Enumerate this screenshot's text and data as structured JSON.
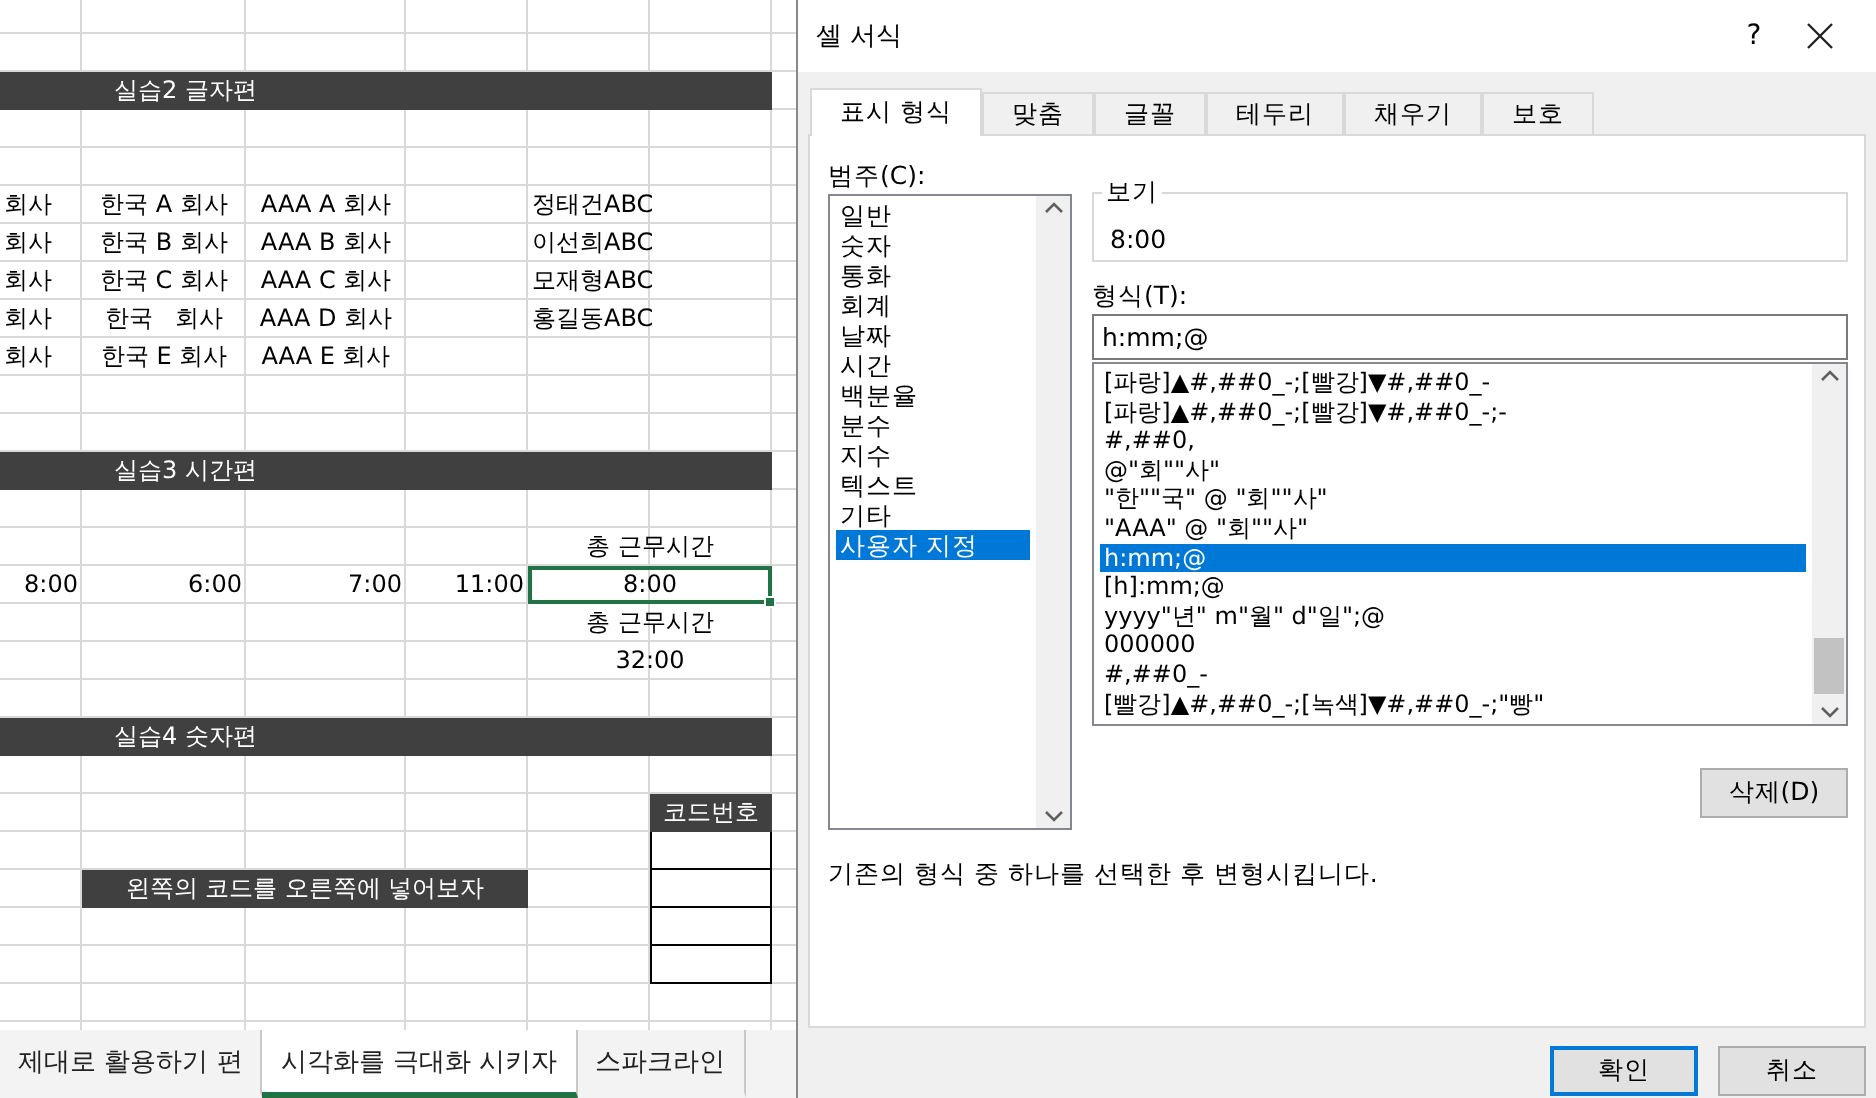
{
  "sheet": {
    "rows": [
      {
        "kind": "blank"
      },
      {
        "kind": "blank"
      },
      {
        "kind": "banner",
        "text": "실습2 글자편"
      },
      {
        "kind": "blank"
      },
      {
        "kind": "blank"
      },
      {
        "kind": "entries",
        "cells": [
          "회사",
          "한국 A 회사",
          "AAA A 회사",
          null,
          "정태건ABC",
          null
        ]
      },
      {
        "kind": "entries",
        "cells": [
          "회사",
          "한국 B 회사",
          "AAA B 회사",
          null,
          "이선희ABC",
          null
        ]
      },
      {
        "kind": "entries",
        "cells": [
          "회사",
          "한국 C 회사",
          "AAA C 회사",
          null,
          "모재형ABC",
          null
        ]
      },
      {
        "kind": "entries",
        "cells": [
          "회사",
          "한국   회사",
          "AAA D 회사",
          null,
          "홍길동ABC",
          null
        ]
      },
      {
        "kind": "entries",
        "cells": [
          "회사",
          "한국 E 회사",
          "AAA E 회사",
          null,
          null,
          null
        ]
      },
      {
        "kind": "blank"
      },
      {
        "kind": "blank"
      },
      {
        "kind": "banner",
        "text": "실습3 시간편"
      },
      {
        "kind": "blank"
      },
      {
        "kind": "caption",
        "text": "총 근무시간"
      },
      {
        "kind": "times",
        "cells": [
          {
            "text": "8:00",
            "selected": false
          },
          {
            "text": "6:00",
            "selected": false
          },
          {
            "text": "7:00",
            "selected": false
          },
          {
            "text": "11:00",
            "selected": false
          }
        ],
        "total": {
          "text": "8:00",
          "selected": true
        }
      },
      {
        "kind": "caption",
        "text": "총 근무시간"
      },
      {
        "kind": "caption",
        "text": "32:00"
      },
      {
        "kind": "blank"
      },
      {
        "kind": "banner",
        "text": "실습4 숫자편"
      },
      {
        "kind": "blank"
      },
      {
        "kind": "code-header",
        "text": "코드번호"
      },
      {
        "kind": "code-box"
      },
      {
        "kind": "code-note",
        "text": "왼쪽의 코드를 오른쪽에 넣어보자"
      },
      {
        "kind": "code-box"
      },
      {
        "kind": "code-box"
      },
      {
        "kind": "blank"
      }
    ]
  },
  "sheet_tabs": [
    {
      "label": "제대로 활용하기 편",
      "selected": false
    },
    {
      "label": "시각화를 극대화 시키자",
      "selected": true
    },
    {
      "label": "스파크라인",
      "selected": false
    }
  ],
  "dialog": {
    "title": "셀 서식",
    "help": "?",
    "tabs": [
      {
        "label": "표시 형식",
        "selected": true
      },
      {
        "label": "맞춤",
        "selected": false
      },
      {
        "label": "글꼴",
        "selected": false
      },
      {
        "label": "테두리",
        "selected": false
      },
      {
        "label": "채우기",
        "selected": false
      },
      {
        "label": "보호",
        "selected": false
      }
    ],
    "category_label": "범주(C):",
    "categories": [
      {
        "label": "일반",
        "selected": false
      },
      {
        "label": "숫자",
        "selected": false
      },
      {
        "label": "통화",
        "selected": false
      },
      {
        "label": "회계",
        "selected": false
      },
      {
        "label": "날짜",
        "selected": false
      },
      {
        "label": "시간",
        "selected": false
      },
      {
        "label": "백분율",
        "selected": false
      },
      {
        "label": "분수",
        "selected": false
      },
      {
        "label": "지수",
        "selected": false
      },
      {
        "label": "텍스트",
        "selected": false
      },
      {
        "label": "기타",
        "selected": false
      },
      {
        "label": "사용자 지정",
        "selected": true
      }
    ],
    "preview_label": "보기",
    "preview_value": "8:00",
    "format_label": "형식(T):",
    "format_value": "h:mm;@",
    "formats": [
      {
        "label": "[파랑]▲#,##0_-;[빨강]▼#,##0_-",
        "selected": false
      },
      {
        "label": "[파랑]▲#,##0_-;[빨강]▼#,##0_-;-",
        "selected": false
      },
      {
        "label": "#,##0,",
        "selected": false
      },
      {
        "label": "@\"회\"\"사\"",
        "selected": false
      },
      {
        "label": "\"한\"\"국\" @ \"회\"\"사\"",
        "selected": false
      },
      {
        "label": "\"AAA\" @ \"회\"\"사\"",
        "selected": false
      },
      {
        "label": "h:mm;@",
        "selected": true
      },
      {
        "label": "[h]:mm;@",
        "selected": false
      },
      {
        "label": "yyyy\"년\" m\"월\" d\"일\";@",
        "selected": false
      },
      {
        "label": "000000",
        "selected": false
      },
      {
        "label": "#,##0_-",
        "selected": false
      },
      {
        "label": "[빨강]▲#,##0_-;[녹색]▼#,##0_-;\"빵\"",
        "selected": false
      }
    ],
    "delete_button": "삭제(D)",
    "description": "기존의 형식 중 하나를 선택한 후 변형시킵니다.",
    "ok_button": "확인",
    "cancel_button": "취소"
  }
}
